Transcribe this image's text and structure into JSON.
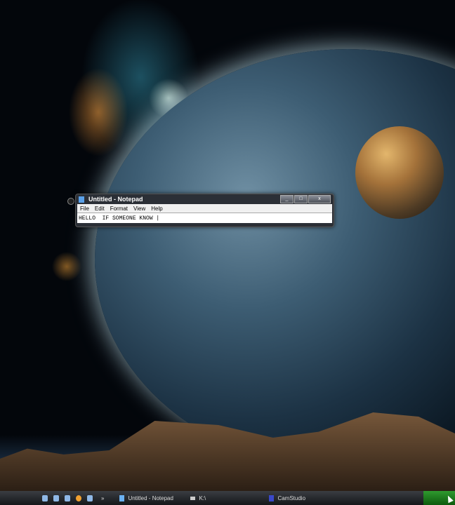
{
  "notepad": {
    "title": "Untitled - Notepad",
    "menu": [
      "File",
      "Edit",
      "Format",
      "View",
      "Help"
    ],
    "content": "HELLO  IF SOMEONE KNOW |",
    "controls": {
      "minimize": "_",
      "maximize": "□",
      "close": "x"
    }
  },
  "taskbar": {
    "quick_launch_more": "»",
    "items": [
      {
        "label": "Untitled - Notepad",
        "icon": "notepad-icon"
      },
      {
        "label": "K:\\",
        "icon": "drive-icon"
      },
      {
        "label": "CamStudio",
        "icon": "camstudio-icon"
      }
    ]
  }
}
